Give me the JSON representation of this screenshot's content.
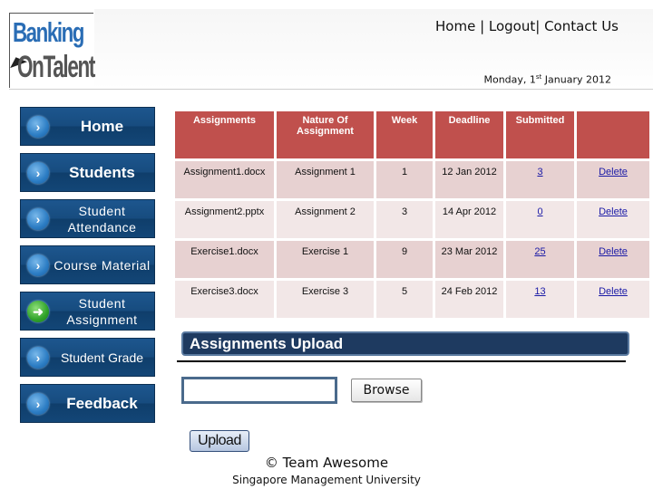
{
  "logo": {
    "line1": "Banking",
    "line2": "OnTalent"
  },
  "topnav": {
    "items": [
      "Home",
      "Logout",
      "Contact Us"
    ],
    "separator": " | "
  },
  "date": {
    "prefix": "Monday, 1",
    "suffix": "st",
    "rest": " January 2012"
  },
  "sidebar": {
    "items": [
      {
        "label": "Home",
        "icon": "chevron-right-icon",
        "active": false
      },
      {
        "label": "Students",
        "icon": "chevron-right-icon",
        "active": false
      },
      {
        "label": "Student Attendance",
        "icon": "chevron-right-icon",
        "active": false
      },
      {
        "label": "Course Material",
        "icon": "chevron-right-icon",
        "active": false
      },
      {
        "label": "Student Assignment",
        "icon": "arrow-right-icon",
        "active": true
      },
      {
        "label": "Student Grade",
        "icon": "chevron-right-icon",
        "active": false
      },
      {
        "label": "Feedback",
        "icon": "chevron-right-icon",
        "active": false
      }
    ]
  },
  "table": {
    "headers": [
      "Assignments",
      "Nature Of Assignment",
      "Week",
      "Deadline",
      "Submitted",
      ""
    ],
    "rows": [
      {
        "file": "Assignment1.docx",
        "nature": "Assignment 1",
        "week": "1",
        "deadline": "12 Jan 2012",
        "submitted": "3",
        "action": "Delete"
      },
      {
        "file": "Assignment2.pptx",
        "nature": "Assignment 2",
        "week": "3",
        "deadline": "14 Apr 2012",
        "submitted": "0",
        "action": "Delete"
      },
      {
        "file": "Exercise1.docx",
        "nature": "Exercise 1",
        "week": "9",
        "deadline": "23 Mar 2012",
        "submitted": "25",
        "action": "Delete"
      },
      {
        "file": "Exercise3.docx",
        "nature": "Exercise 3",
        "week": "5",
        "deadline": "24 Feb 2012",
        "submitted": "13",
        "action": "Delete"
      }
    ]
  },
  "upload": {
    "title": "Assignments Upload",
    "file_value": "",
    "browse_label": "Browse",
    "upload_label": "Upload"
  },
  "footer": {
    "copyright": "© Team Awesome",
    "org": "Singapore Management University"
  },
  "colors": {
    "header_red": "#c0504d",
    "row_dark": "#e7d1d1",
    "row_light": "#f2e7e7",
    "nav_blue": "#174c7f",
    "upload_bar": "#1e3a60"
  }
}
